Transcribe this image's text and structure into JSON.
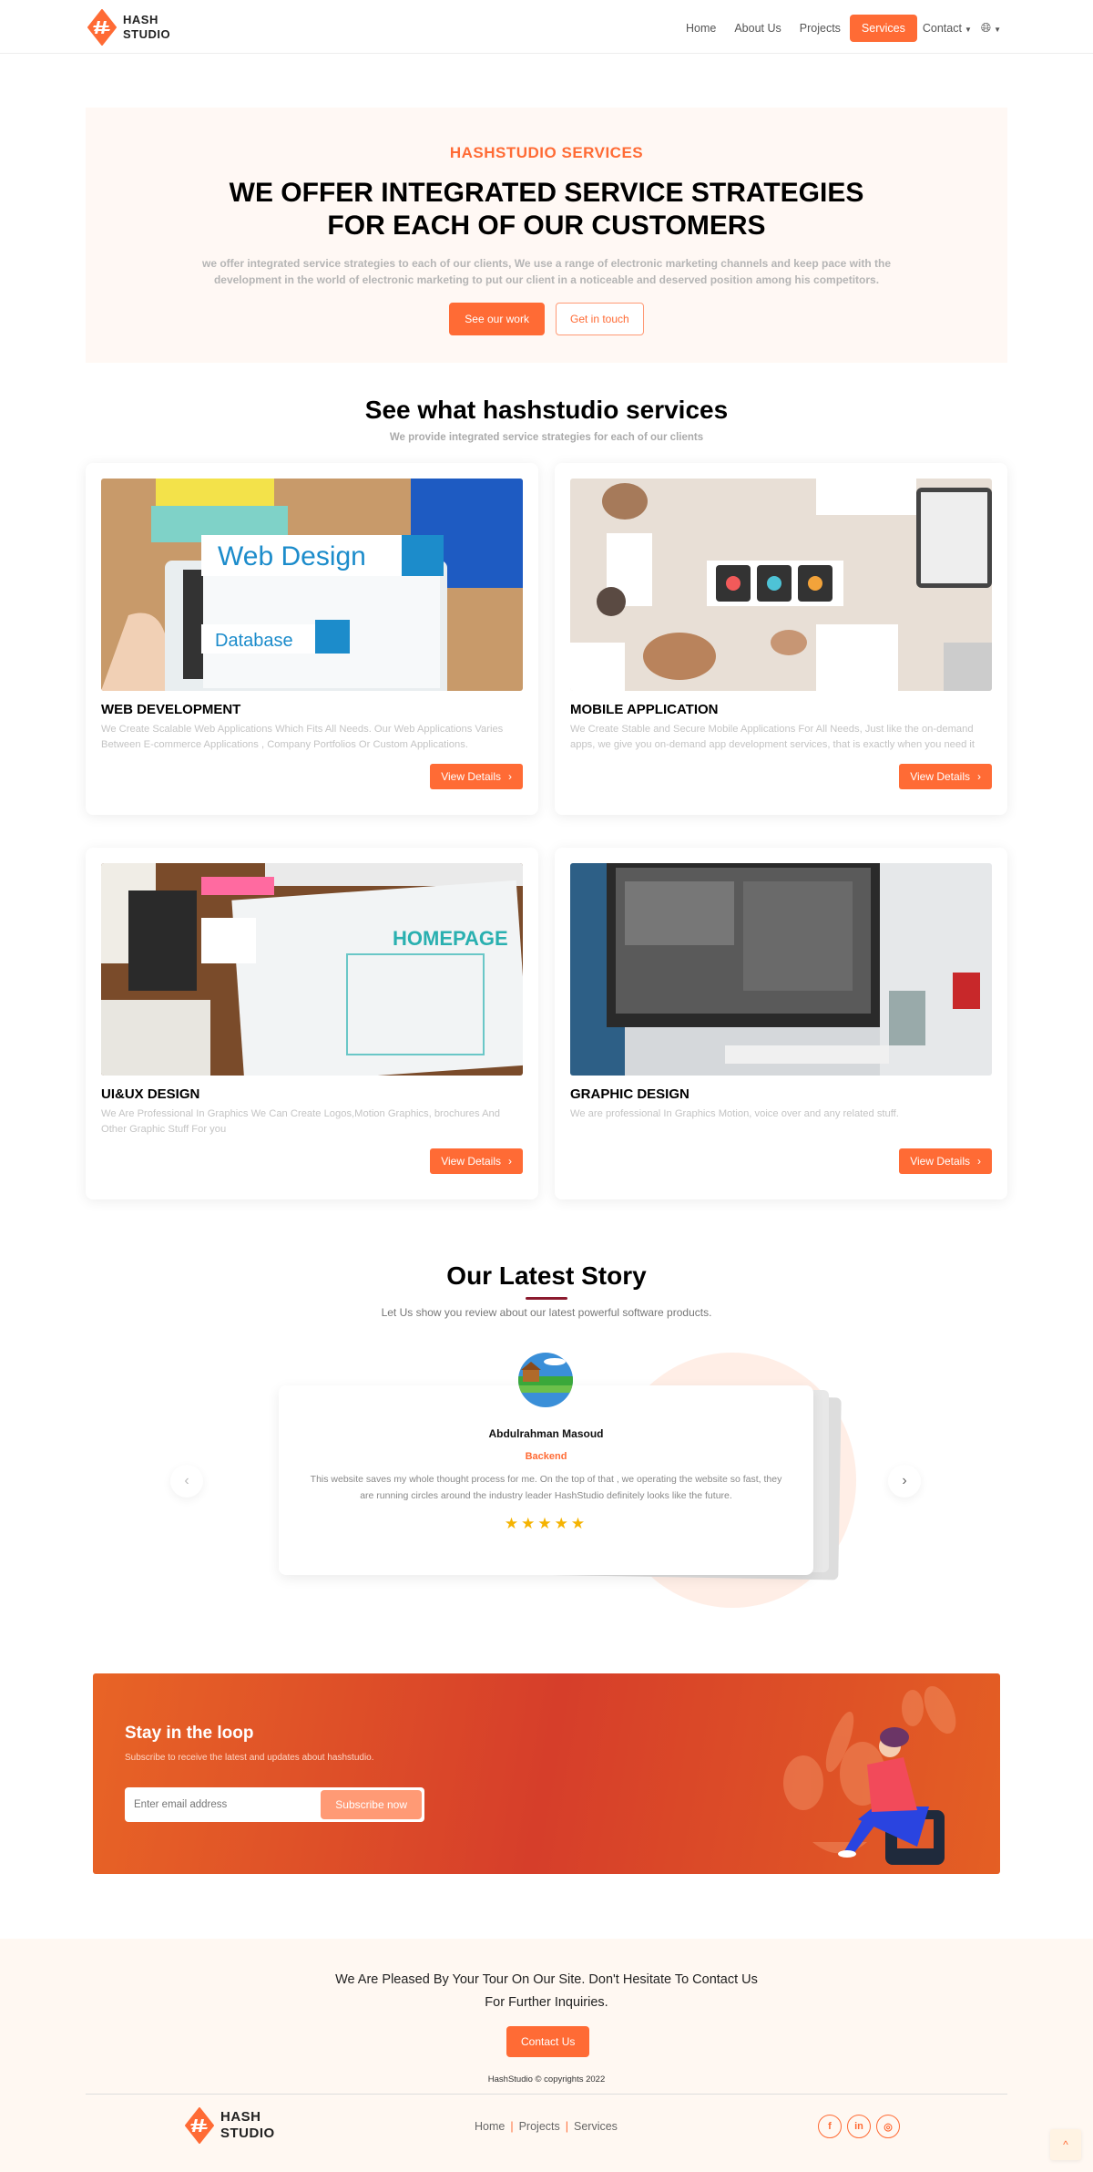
{
  "brand": {
    "line1": "HASH",
    "line2": "STUDIO",
    "accent": "#ff6b35"
  },
  "nav": {
    "items": [
      {
        "label": "Home"
      },
      {
        "label": "About Us"
      },
      {
        "label": "Projects"
      },
      {
        "label": "Services",
        "active": true
      },
      {
        "label": "Contact",
        "dropdown": true
      }
    ],
    "language_icon": "globe-icon"
  },
  "hero": {
    "kicker": "HASHSTUDIO SERVICES",
    "title": "WE OFFER INTEGRATED SERVICE STRATEGIES FOR EACH OF OUR CUSTOMERS",
    "description": "we offer integrated service strategies to each of our clients, We use a range of electronic marketing channels and keep pace with the development in the world of electronic marketing to put our client in a noticeable and deserved position among his competitors.",
    "primary_button": "See our work",
    "secondary_button": "Get in touch"
  },
  "services": {
    "title": "See what hashstudio services",
    "subtitle": "We provide integrated service strategies for each of our clients",
    "cards": [
      {
        "title": "WEB DEVELOPMENT",
        "description": " We Create Scalable Web Applications Which Fits All Needs. Our Web Applications Varies Between E-commerce Applications , Company Portfolios Or Custom Applications.",
        "button": "View Details",
        "image": "web-design-tablet-image"
      },
      {
        "title": "MOBILE APPLICATION",
        "description": " We Create Stable and Secure Mobile Applications For All Needs, Just like the on-demand apps, we give you on-demand app development services, that is exactly when you need it and",
        "button": "View Details",
        "image": "mobile-app-wireframes-image"
      },
      {
        "title": "UI&UX DESIGN",
        "description": " We Are Professional In Graphics We Can Create Logos,Motion Graphics, brochures And Other Graphic Stuff For you",
        "button": "View Details",
        "image": "homepage-sketch-image"
      },
      {
        "title": "GRAPHIC DESIGN",
        "description": " We are professional In Graphics Motion, voice over and any related stuff.",
        "button": "View Details",
        "image": "designer-monitor-image"
      }
    ]
  },
  "story": {
    "title": "Our Latest Story",
    "subtitle": "Let Us show you review about our latest powerful software products.",
    "review": {
      "name": "Abdulrahman Masoud",
      "role": "Backend",
      "text": "This website saves my whole thought process for me. On the top of that , we operating the website so fast, they are running circles around the industry leader HashStudio definitely looks like the future.",
      "rating": 5,
      "rating_max": 5,
      "stars": "★★★★★"
    },
    "prev_icon": "‹",
    "next_icon": "›"
  },
  "newsletter": {
    "title": "Stay in the loop",
    "subtitle": "Subscribe to receive the latest and updates about hashstudio.",
    "placeholder": "Enter email address",
    "button": "Subscribe now"
  },
  "footer": {
    "message": "We Are Pleased By Your Tour On Our Site. Don't Hesitate To Contact Us For Further Inquiries.",
    "button": "Contact Us",
    "copyright": "HashStudio © copyrights 2022",
    "links": [
      {
        "label": "Home"
      },
      {
        "label": "Projects"
      },
      {
        "label": "Services"
      }
    ],
    "socials": [
      {
        "name": "facebook",
        "glyph": "f"
      },
      {
        "name": "linkedin",
        "glyph": "in"
      },
      {
        "name": "instagram",
        "glyph": "◎"
      }
    ],
    "to_top": "^"
  }
}
